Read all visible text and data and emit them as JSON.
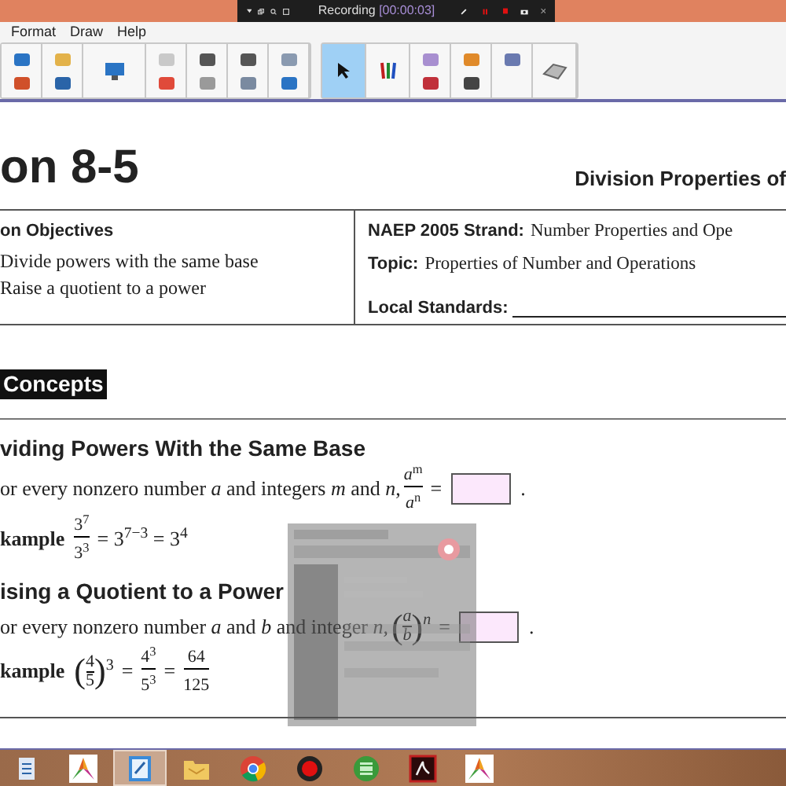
{
  "recorder_bar": {
    "label": "Recording ",
    "time": "[00:00:03]"
  },
  "menu": [
    "Format",
    "Draw",
    "Help"
  ],
  "tools": [
    {
      "kind": "redo-open",
      "selected": false
    },
    {
      "kind": "folder-save",
      "selected": false
    },
    {
      "kind": "monitor",
      "selected": false
    },
    {
      "kind": "copy-delete",
      "selected": false
    },
    {
      "kind": "image-screen",
      "selected": false
    },
    {
      "kind": "text-table",
      "selected": false
    },
    {
      "kind": "globe-fit",
      "selected": false
    },
    {
      "kind": "pointer",
      "selected": true
    },
    {
      "kind": "pens",
      "selected": false
    },
    {
      "kind": "eraser-text",
      "selected": false
    },
    {
      "kind": "shape-line",
      "selected": false
    },
    {
      "kind": "fill",
      "selected": false
    },
    {
      "kind": "clear",
      "selected": false
    }
  ],
  "document": {
    "lesson_title": "on 8-5",
    "lesson_subtitle": "Division Properties of",
    "objectives": {
      "heading": "on Objectives",
      "items": [
        "Divide powers with the same base",
        "Raise a quotient to a power"
      ]
    },
    "strand": {
      "label": "NAEP 2005 Strand:",
      "value": "Number Properties and Ope"
    },
    "topic": {
      "label": "Topic:",
      "value": "Properties of Number and Operations"
    },
    "local_standards": {
      "label": "Local Standards:"
    },
    "concepts_heading": "Concepts",
    "concepts": [
      {
        "title": "viding Powers With the Same Base",
        "rule": "or every nonzero number *a* and integers *m* and *n*,",
        "rule_math": [
          {
            "kind": "frac",
            "num": "*a*$^{m}$",
            "den": "*a*$^{n}$"
          },
          {
            "kind": "text",
            "text": "="
          },
          {
            "kind": "blank"
          },
          {
            "kind": "text",
            "text": "."
          }
        ],
        "example_label": "kample",
        "example_math": [
          {
            "kind": "frac",
            "num": "3$^{7}$",
            "den": "3$^{3}$"
          },
          {
            "kind": "text",
            "text": "= 3$^{7−3}$ = 3$^{4}$"
          }
        ]
      },
      {
        "title": "ising a Quotient to a Power",
        "rule": "or every nonzero number *a* and *b* and integer *n*,",
        "rule_math": [
          {
            "kind": "paren",
            "open": "(",
            "num": "*a*",
            "den": "*b*",
            "close": ")",
            "exp": "*n*"
          },
          {
            "kind": "text",
            "text": "="
          },
          {
            "kind": "blank"
          },
          {
            "kind": "text",
            "text": "."
          }
        ],
        "example_label": "kample",
        "example_math": [
          {
            "kind": "paren",
            "open": "(",
            "num": "4",
            "den": "5",
            "close": ")",
            "exp": "3"
          },
          {
            "kind": "text",
            "text": "="
          },
          {
            "kind": "frac",
            "num": "4$^{3}$",
            "den": "5$^{3}$"
          },
          {
            "kind": "text",
            "text": "="
          },
          {
            "kind": "frac",
            "num": "64",
            "den": "125"
          }
        ]
      }
    ]
  },
  "taskbar": [
    {
      "kind": "doc",
      "selected": false
    },
    {
      "kind": "triangle-app",
      "selected": false
    },
    {
      "kind": "notepad",
      "selected": true
    },
    {
      "kind": "folder",
      "selected": false
    },
    {
      "kind": "chrome",
      "selected": false
    },
    {
      "kind": "record",
      "selected": false
    },
    {
      "kind": "film",
      "selected": false
    },
    {
      "kind": "pdf",
      "selected": false
    },
    {
      "kind": "triangle-app",
      "selected": false
    }
  ]
}
